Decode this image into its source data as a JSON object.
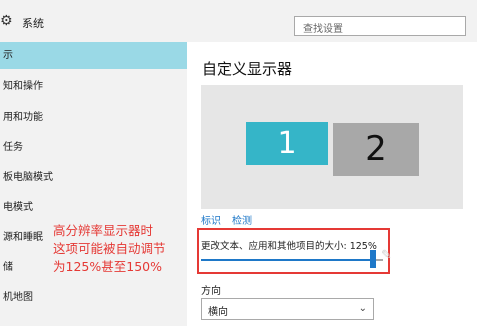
{
  "window": {
    "title": "系统"
  },
  "search": {
    "placeholder": "查找设置"
  },
  "sidebar": {
    "items": [
      {
        "label": "示"
      },
      {
        "label": "知和操作"
      },
      {
        "label": "用和功能"
      },
      {
        "label": "任务"
      },
      {
        "label": "板电脑模式"
      },
      {
        "label": "电模式"
      },
      {
        "label": "源和睡眠"
      },
      {
        "label": "储"
      },
      {
        "label": "机地图"
      }
    ],
    "selected_index": 0
  },
  "main": {
    "heading": "自定义显示器",
    "monitors": [
      {
        "label": "1"
      },
      {
        "label": "2"
      }
    ],
    "identify_link": "标识",
    "detect_link": "检测",
    "scale_label": "更改文本、应用和其他项目的大小: 125%",
    "scale_level_fraction": 0.93,
    "orientation_label": "方向",
    "orientation_value": "横向"
  },
  "annotation": {
    "lines": [
      "高分辨率显示器时",
      "这项可能被自动调节",
      "为125%甚至150%"
    ]
  },
  "colors": {
    "accent": "#1e78c8",
    "selected_bg": "#9ad9e6",
    "monitor1": "#35b5c8",
    "monitor2": "#a8a8a8",
    "annotation": "#e53935"
  }
}
